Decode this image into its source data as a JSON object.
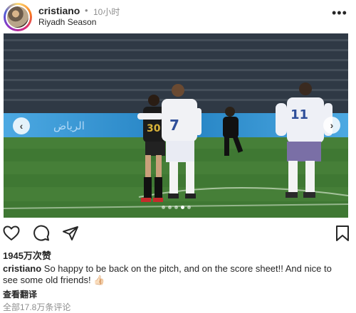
{
  "header": {
    "username": "cristiano",
    "separator": "•",
    "time": "10小时",
    "location": "Riyadh Season",
    "more_label": "•••"
  },
  "photo": {
    "prev_label": "‹",
    "next_label": "›",
    "slide_count": 5,
    "active_slide": 4,
    "player_left_number": "30",
    "player_center_number": "7",
    "player_right_number": "11",
    "banner_text": "الرياض"
  },
  "actions": {
    "icons": [
      "heart-icon",
      "comment-icon",
      "share-icon",
      "bookmark-icon"
    ]
  },
  "likes": "1945万次赞",
  "caption": {
    "username": "cristiano",
    "text": " So happy to be back on the pitch, and on the score sheet!! And nice to see some old friends! 👍🏻"
  },
  "see_translation": "查看翻译",
  "view_comments": "全部17.8万条评论"
}
